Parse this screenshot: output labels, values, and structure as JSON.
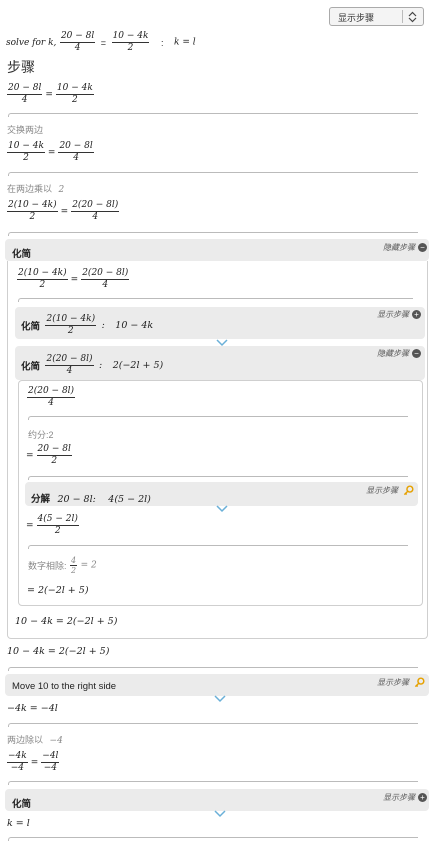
{
  "dropdown": {
    "label": "显示步骤"
  },
  "header": {
    "solve_prefix": "solve for k,",
    "lhs_num": "20 − 8l",
    "lhs_den": "4",
    "rhs_num": "10 − 4k",
    "rhs_den": "2",
    "colon": ":",
    "result": "k = l"
  },
  "steps_title": "步骤",
  "eq1": {
    "a_num": "20 − 8l",
    "a_den": "4",
    "b_num": "10 − 4k",
    "b_den": "2"
  },
  "swap_label": "交换两边",
  "eq2": {
    "a_num": "10 − 4k",
    "a_den": "2",
    "b_num": "20 − 8l",
    "b_den": "4"
  },
  "mult_label": "在两边乘以",
  "mult_value": "2",
  "eq3": {
    "a_num": "2(10 − 4k)",
    "a_den": "2",
    "b_num": "2(20 − 8l)",
    "b_den": "4"
  },
  "simplify_block": {
    "label": "化简",
    "hide_label": "隐藏步骤",
    "inner_eq": {
      "a_num": "2(10 − 4k)",
      "a_den": "2",
      "b_num": "2(20 − 8l)",
      "b_den": "4"
    },
    "sub1": {
      "label": "化简",
      "num": "2(10 − 4k)",
      "den": "2",
      "result": "10 − 4k",
      "show_label": "显示步骤"
    },
    "sub2": {
      "label": "化简",
      "num": "2(20 − 8l)",
      "den": "4",
      "result": "2(−2l + 5)",
      "hide_label": "隐藏步骤",
      "start_num": "2(20 − 8l)",
      "start_den": "4",
      "reduce_label": "约分:",
      "reduce_value": "2",
      "step2_num": "20 − 8l",
      "step2_den": "2",
      "factor": {
        "label": "分解",
        "expr": "20 − 8l:",
        "result": "4(5 − 2l)",
        "show_label": "显示步骤"
      },
      "step3_num": "4(5 − 2l)",
      "step3_den": "2",
      "cancel_label": "数字相除:",
      "cancel_num": "4",
      "cancel_den": "2",
      "cancel_result": "= 2",
      "final": "= 2(−2l + 5)"
    },
    "inner_result": "10 − 4k = 2(−2l + 5)"
  },
  "result_after_simplify": "10 − 4k = 2(−2l + 5)",
  "move_block": {
    "label": "Move 10 to the right side",
    "show_label": "显示步骤"
  },
  "eq_move": "−4k = −4l",
  "divide_label": "两边除以",
  "divide_value": "−4",
  "eq_div": {
    "a_num": "−4k",
    "a_den": "−4",
    "b_num": "−4l",
    "b_den": "−4"
  },
  "simplify2": {
    "label": "化简",
    "show_label": "显示步骤"
  },
  "final_answer": "k = l"
}
